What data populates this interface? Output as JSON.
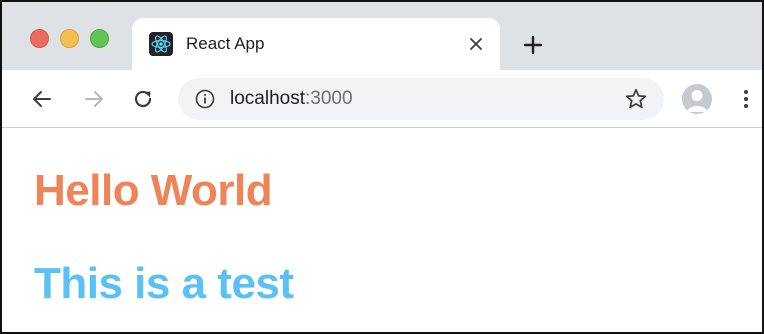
{
  "tab": {
    "title": "React App",
    "favicon": "react-logo-icon"
  },
  "address_bar": {
    "host": "localhost",
    "port": ":3000"
  },
  "page": {
    "heading_primary": "Hello World",
    "heading_secondary": "This is a test"
  },
  "colors": {
    "heading_primary": "#ef8459",
    "heading_secondary": "#5cc0f5",
    "titlebar": "#dee1e6",
    "omnibox": "#f1f3f4"
  },
  "icons": {
    "traffic_lights": [
      "close-dot",
      "minimize-dot",
      "maximize-dot"
    ],
    "tab_close": "close-icon",
    "new_tab": "plus-icon",
    "back": "arrow-left-icon",
    "forward": "arrow-right-icon",
    "reload": "reload-icon",
    "site_info": "info-icon",
    "bookmark": "star-icon",
    "profile": "profile-icon",
    "menu": "more-vertical-icon"
  }
}
